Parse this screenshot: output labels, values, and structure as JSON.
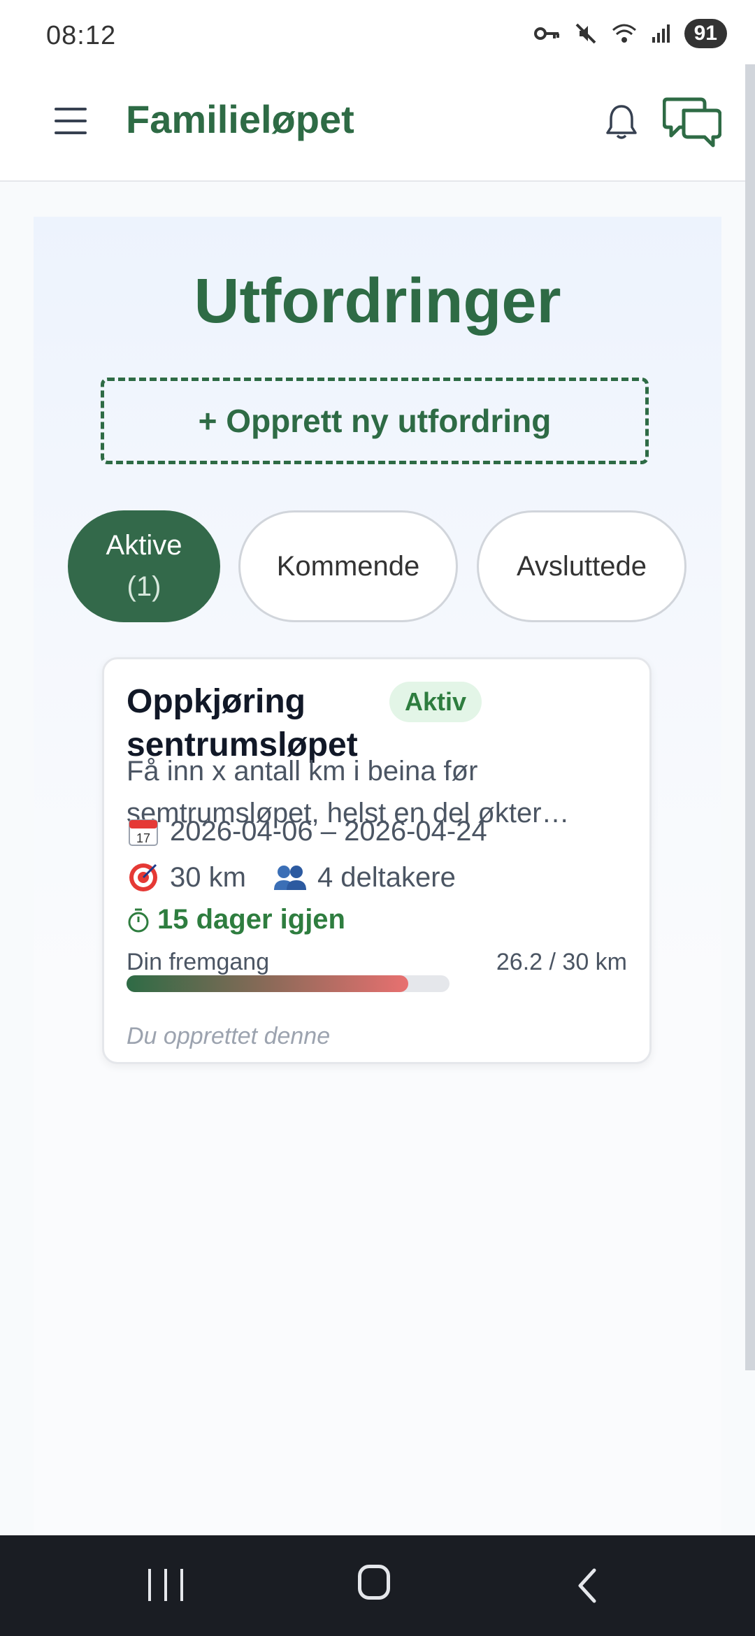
{
  "status_bar": {
    "time": "08:12",
    "battery": "91"
  },
  "app_bar": {
    "title": "Familieløpet"
  },
  "page": {
    "title": "Utfordringer",
    "create_button": "+ Opprett ny utfordring",
    "tabs": [
      {
        "label": "Aktive",
        "count": "(1)"
      },
      {
        "label": "Kommende"
      },
      {
        "label": "Avsluttede"
      }
    ]
  },
  "challenge": {
    "title": "Oppkjøring sentrumsløpet",
    "status": "Aktiv",
    "description": "Få inn x antall km i beina før semtrumsløpet, helst en del økter…",
    "dates": "2026-04-06 – 2026-04-24",
    "goal": "30 km",
    "participants": "4 deltakere",
    "time_left": "15 dager igjen",
    "progress_label": "Din fremgang",
    "progress_text": "26.2 / 30 km",
    "progress_fraction": 0.873,
    "footer": "Du opprettet denne"
  },
  "icons": {
    "calendar": "calendar-icon",
    "target": "target-icon",
    "people": "people-icon",
    "timer": "timer-icon"
  },
  "colors": {
    "brand_green": "#2e6b45",
    "badge_bg": "#e3f5e7",
    "progress_end": "#e87070"
  }
}
